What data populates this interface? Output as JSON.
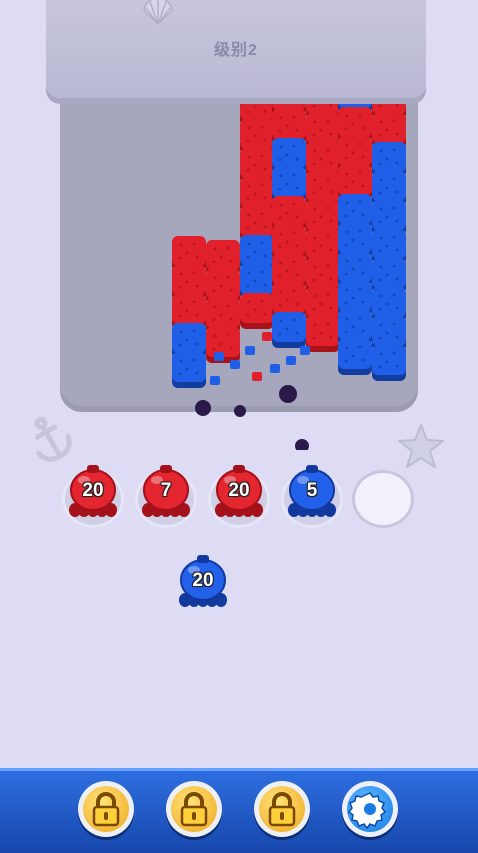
{
  "level": {
    "label": "级别2"
  },
  "colors": {
    "red": "#e0202a",
    "blue": "#1f5fe8",
    "pit": "#a6a6bd",
    "background": "#dedcf4"
  },
  "slots": [
    {
      "color": "red",
      "count": "20"
    },
    {
      "color": "red",
      "count": "7"
    },
    {
      "color": "red",
      "count": "20"
    },
    {
      "color": "blue",
      "count": "5"
    },
    {
      "color": "empty",
      "count": ""
    }
  ],
  "queue": [
    {
      "color": "blue",
      "count": "20"
    }
  ],
  "toolbar": {
    "buttons": [
      {
        "icon": "lock-icon",
        "state": "locked"
      },
      {
        "icon": "lock-icon",
        "state": "locked"
      },
      {
        "icon": "lock-icon",
        "state": "locked"
      },
      {
        "icon": "gear-icon",
        "state": "settings"
      }
    ]
  },
  "decorations": [
    "shell-icon",
    "anchor-icon",
    "starfish-icon"
  ]
}
